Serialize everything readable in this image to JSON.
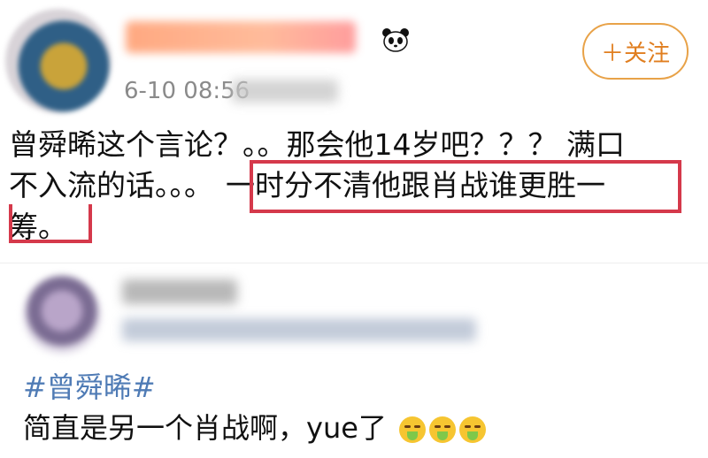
{
  "post1": {
    "timestamp": "6-10 08:56",
    "follow_label": "＋关注",
    "text_line1": "曾舜晞这个言论？。。那会他14岁吧？？？ 满口",
    "text_line2_a": "不入流的话。。。",
    "text_line2_b": "一时分不清他跟肖战谁更胜一",
    "text_line3": "筹。"
  },
  "post2": {
    "hashtag": "#曾舜晞#",
    "text": "简直是另一个肖战啊，yue了"
  },
  "icons": {
    "panda": "panda-badge-icon",
    "emoji": "vomit-emoji-icon"
  },
  "colors": {
    "highlight_border": "#d5394b",
    "follow_accent": "#e07e1f",
    "hashtag": "#4f7bb5"
  }
}
